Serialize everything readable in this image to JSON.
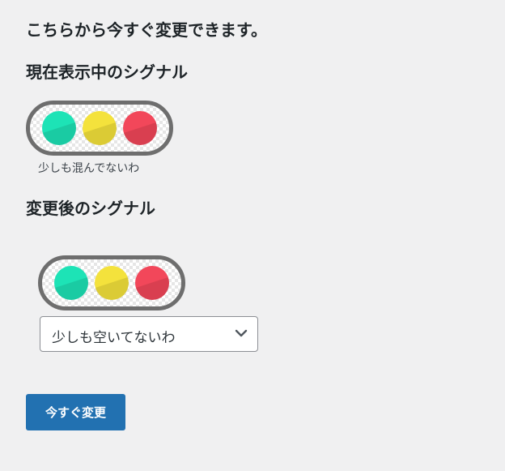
{
  "intro": {
    "title": "こちらから今すぐ変更できます。"
  },
  "current": {
    "heading": "現在表示中のシグナル",
    "caption": "少しも混んでないわ"
  },
  "new_signal": {
    "heading": "変更後のシグナル",
    "select_value": "少しも空いてないわ"
  },
  "actions": {
    "submit_label": "今すぐ変更"
  },
  "signal_colors": {
    "green": "#1de3b6",
    "yellow": "#f4e23c",
    "red": "#f2475a"
  },
  "icons": {
    "select_arrow": "chevron-down-icon"
  },
  "colors": {
    "button_primary": "#2271b1",
    "background": "#f0f0f1",
    "signal_border": "#6e6e6e"
  }
}
